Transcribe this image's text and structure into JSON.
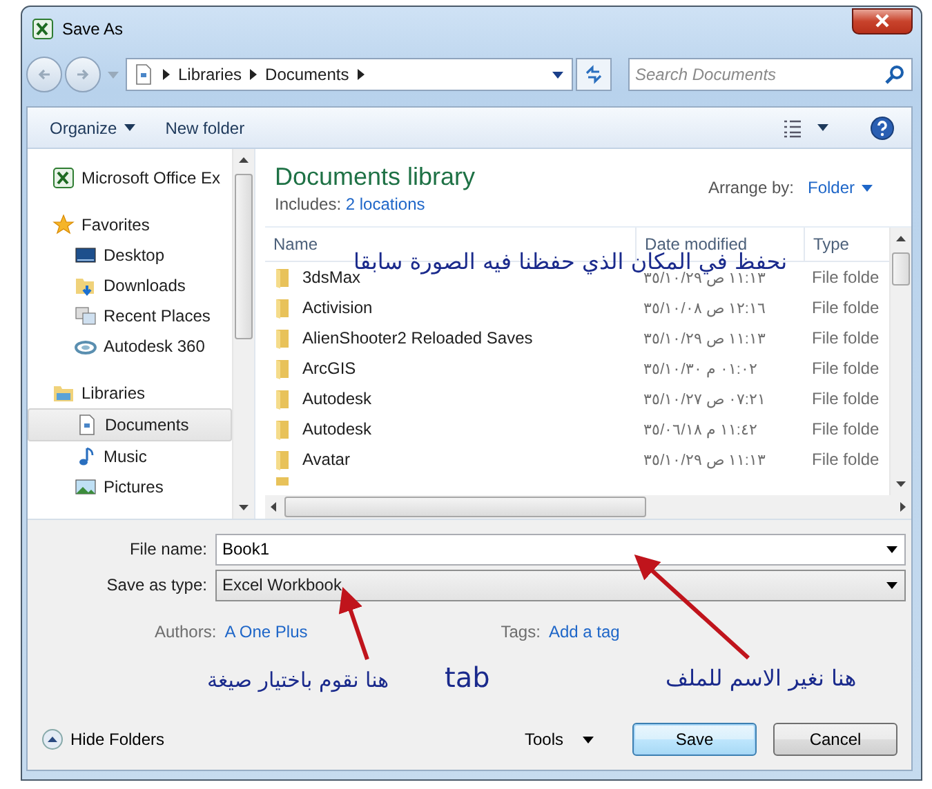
{
  "window": {
    "title": "Save As"
  },
  "address_bar": {
    "path": [
      "Libraries",
      "Documents"
    ],
    "search_placeholder": "Search Documents"
  },
  "toolbar": {
    "organize": "Organize",
    "new_folder": "New folder"
  },
  "sidebar": {
    "items": [
      {
        "label": "Microsoft Office Ex",
        "kind": "excel",
        "selected": false
      },
      {
        "label": "Favorites",
        "kind": "star",
        "selected": false,
        "children": [
          {
            "label": "Desktop",
            "kind": "desktop",
            "selected": false
          },
          {
            "label": "Downloads",
            "kind": "downloads",
            "selected": false
          },
          {
            "label": "Recent Places",
            "kind": "recent",
            "selected": false
          },
          {
            "label": "Autodesk 360",
            "kind": "cloud",
            "selected": false
          }
        ]
      },
      {
        "label": "Libraries",
        "kind": "library",
        "selected": false,
        "children": [
          {
            "label": "Documents",
            "kind": "documents",
            "selected": true
          },
          {
            "label": "Music",
            "kind": "music",
            "selected": false
          },
          {
            "label": "Pictures",
            "kind": "pictures",
            "selected": false
          }
        ]
      }
    ]
  },
  "library": {
    "title": "Documents library",
    "includes_label": "Includes:",
    "includes_link": "2 locations",
    "arrange_label": "Arrange by:",
    "arrange_value": "Folder"
  },
  "table": {
    "columns": [
      "Name",
      "Date modified",
      "Type"
    ],
    "rows": [
      {
        "name": "3dsMax",
        "date": "١١:١٣ ص ٣٥/١٠/٢٩",
        "type": "File folde"
      },
      {
        "name": "Activision",
        "date": "١٢:١٦ ص ٣٥/١٠/٠٨",
        "type": "File folde"
      },
      {
        "name": "AlienShooter2 Reloaded Saves",
        "date": "١١:١٣ ص ٣٥/١٠/٢٩",
        "type": "File folde"
      },
      {
        "name": "ArcGIS",
        "date": "٠١:٠٢ م ٣٥/١٠/٣٠",
        "type": "File folde"
      },
      {
        "name": "Autodesk",
        "date": "٠٧:٢١ ص ٣٥/١٠/٢٧",
        "type": "File folde"
      },
      {
        "name": "Autodesk",
        "date": "١١:٤٢ م ٣٥/٠٦/١٨",
        "type": "File folde"
      },
      {
        "name": "Avatar",
        "date": "١١:١٣ ص ٣٥/١٠/٢٩",
        "type": "File folde"
      }
    ]
  },
  "form": {
    "file_name": {
      "label": "File name:",
      "value": "Book1"
    },
    "save_as_type": {
      "label": "Save as type:",
      "value": "Excel Workbook"
    },
    "authors": {
      "label": "Authors:",
      "value": "A One Plus"
    },
    "tags": {
      "label": "Tags:",
      "value": "Add a tag"
    }
  },
  "footer": {
    "hide_folders": "Hide Folders",
    "tools": "Tools",
    "buttons": [
      "Save",
      "Cancel"
    ]
  },
  "annotations": [
    {
      "text": "نحفظ في المكان الذي حفظنا فيه الصورة سابقا",
      "kind": "top"
    },
    {
      "text": "هنا نغير الاسم للملف",
      "kind": "right"
    },
    {
      "text": "tab",
      "kind": "latin"
    },
    {
      "text": "هنا نقوم باختيار صيغة",
      "kind": "left"
    }
  ]
}
